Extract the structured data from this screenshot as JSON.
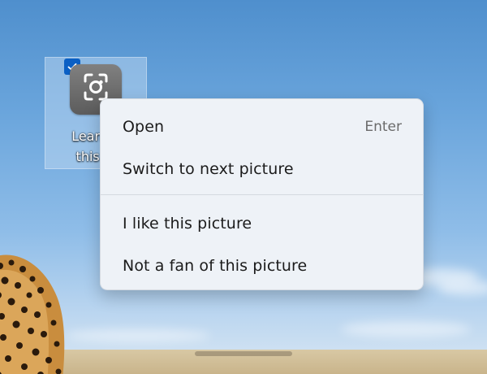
{
  "desktop": {
    "icon": {
      "label_line1": "Learn a",
      "label_line2": "this pi",
      "selected": true,
      "icon_name": "camera-lens-icon",
      "tile_color": "#6f6f6f"
    }
  },
  "context_menu": {
    "items": [
      {
        "label": "Open",
        "shortcut": "Enter"
      },
      {
        "label": "Switch to next picture",
        "shortcut": ""
      },
      {
        "label": "I like this picture",
        "shortcut": ""
      },
      {
        "label": "Not a fan of this picture",
        "shortcut": ""
      }
    ]
  },
  "colors": {
    "menu_background": "#eef2f7",
    "selection_check": "#0a5fc4",
    "sky_top": "#4f8fcd",
    "sky_bottom": "#d9e7f3"
  }
}
